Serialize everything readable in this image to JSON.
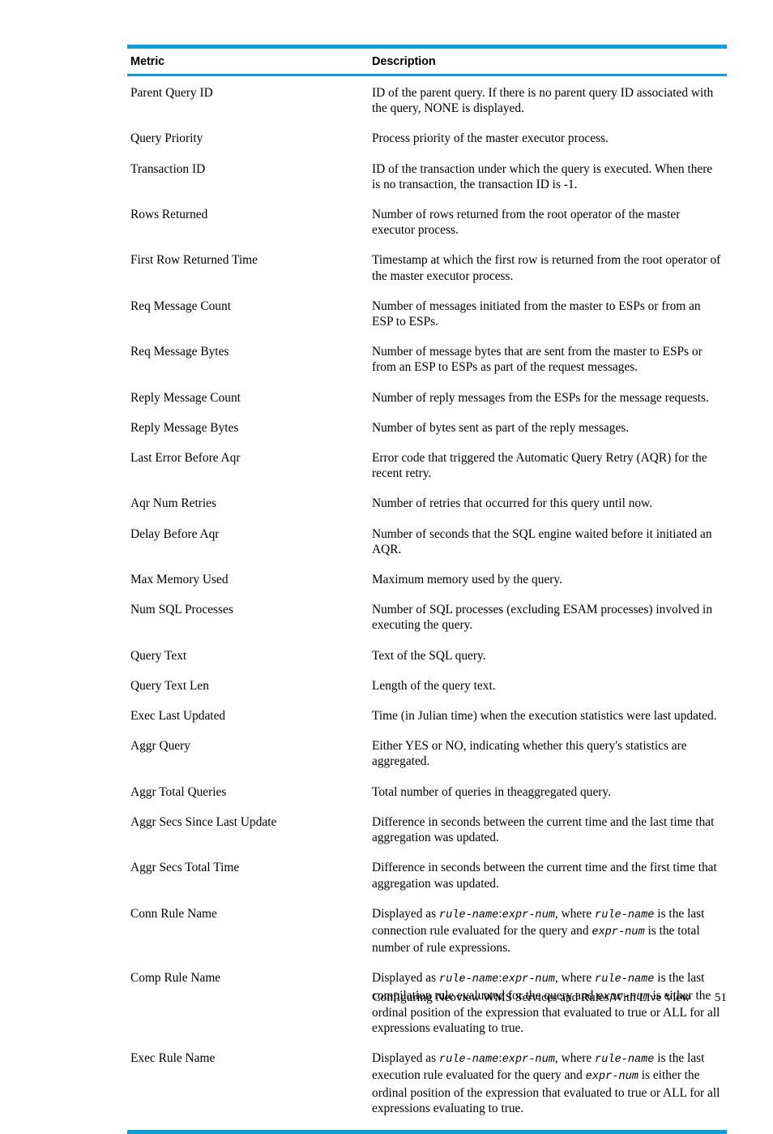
{
  "document": {
    "table": {
      "columns": [
        "Metric",
        "Description"
      ],
      "rows": [
        {
          "metric": "Parent Query ID",
          "description": "ID of the parent query. If there is no parent query ID associated with the query, NONE is displayed."
        },
        {
          "metric": "Query Priority",
          "description": "Process priority of the master executor process."
        },
        {
          "metric": "Transaction ID",
          "description": "ID of the transaction under which the query is executed. When there is no transaction, the transaction ID is -1."
        },
        {
          "metric": "Rows Returned",
          "description": "Number of rows returned from the root operator of the master executor process."
        },
        {
          "metric": "First Row Returned Time",
          "description": "Timestamp at which the first row is returned from the root operator of the master executor process."
        },
        {
          "metric": "Req Message Count",
          "description": "Number of messages initiated from the master to ESPs or from an ESP to ESPs."
        },
        {
          "metric": "Req Message Bytes",
          "description": "Number of message bytes that are sent from the master to ESPs or from an ESP to ESPs as part of the request messages."
        },
        {
          "metric": "Reply Message Count",
          "description": "Number of reply messages from the ESPs for the message requests."
        },
        {
          "metric": "Reply Message Bytes",
          "description": "Number of bytes sent as part of the reply messages."
        },
        {
          "metric": "Last Error Before Aqr",
          "description": "Error code that triggered the Automatic Query Retry (AQR) for the recent retry."
        },
        {
          "metric": "Aqr Num Retries",
          "description": "Number of retries that occurred for this query until now."
        },
        {
          "metric": "Delay Before Aqr",
          "description": "Number of seconds that the SQL engine waited before it initiated an AQR."
        },
        {
          "metric": "Max Memory Used",
          "description": "Maximum memory used by the query."
        },
        {
          "metric": "Num SQL Processes",
          "description": "Number of SQL processes (excluding ESAM processes) involved in executing the query."
        },
        {
          "metric": "Query Text",
          "description": "Text of the SQL query."
        },
        {
          "metric": "Query Text Len",
          "description": "Length of the query text."
        },
        {
          "metric": "Exec Last Updated",
          "description": "Time (in Julian time) when the execution statistics were last updated."
        },
        {
          "metric": "Aggr Query",
          "description": "Either YES or NO, indicating whether this query's statistics are aggregated."
        },
        {
          "metric": "Aggr Total Queries",
          "description": "Total number of queries in theaggregated query."
        },
        {
          "metric": "Aggr Secs Since Last Update",
          "description": "Difference in seconds between the current time and the last time that aggregation was updated."
        },
        {
          "metric": "Aggr Secs Total Time",
          "description": "Difference in seconds between the current time and the first time that aggregation was updated."
        },
        {
          "metric": "Conn Rule Name",
          "description_parts": [
            {
              "type": "text",
              "text": "Displayed as "
            },
            {
              "type": "mono",
              "text": "rule-name"
            },
            {
              "type": "text",
              "text": ":"
            },
            {
              "type": "mono",
              "text": "expr-num"
            },
            {
              "type": "text",
              "text": ", where "
            },
            {
              "type": "mono",
              "text": "rule-name"
            },
            {
              "type": "text",
              "text": " is the last connection rule evaluated for the query and "
            },
            {
              "type": "mono",
              "text": "expr-num"
            },
            {
              "type": "text",
              "text": " is the total number of rule expressions."
            }
          ]
        },
        {
          "metric": "Comp Rule Name",
          "description_parts": [
            {
              "type": "text",
              "text": "Displayed as "
            },
            {
              "type": "mono",
              "text": "rule-name"
            },
            {
              "type": "text",
              "text": ":"
            },
            {
              "type": "mono",
              "text": "expr-num"
            },
            {
              "type": "text",
              "text": ", where "
            },
            {
              "type": "mono",
              "text": "rule-name"
            },
            {
              "type": "text",
              "text": " is the last compilation rule evaluated for the query and "
            },
            {
              "type": "mono",
              "text": "expr-num"
            },
            {
              "type": "text",
              "text": " is either the ordinal position of the expression that evaluated to true or ALL for all expressions evaluating to true."
            }
          ]
        },
        {
          "metric": "Exec Rule Name",
          "description_parts": [
            {
              "type": "text",
              "text": "Displayed as "
            },
            {
              "type": "mono",
              "text": "rule-name"
            },
            {
              "type": "text",
              "text": ":"
            },
            {
              "type": "mono",
              "text": "expr-num"
            },
            {
              "type": "text",
              "text": ", where "
            },
            {
              "type": "mono",
              "text": "rule-name"
            },
            {
              "type": "text",
              "text": " is the last execution rule evaluated for the query and "
            },
            {
              "type": "mono",
              "text": "expr-num"
            },
            {
              "type": "text",
              "text": " is either the ordinal position of the expression that evaluated to true or ALL for all expressions evaluating to true."
            }
          ]
        }
      ]
    },
    "footer": {
      "title": "Configuring Neoview WMS Services and Rules With Live View",
      "page_number": "51"
    },
    "colors": {
      "rule_blue": "#0d9ddb"
    }
  }
}
